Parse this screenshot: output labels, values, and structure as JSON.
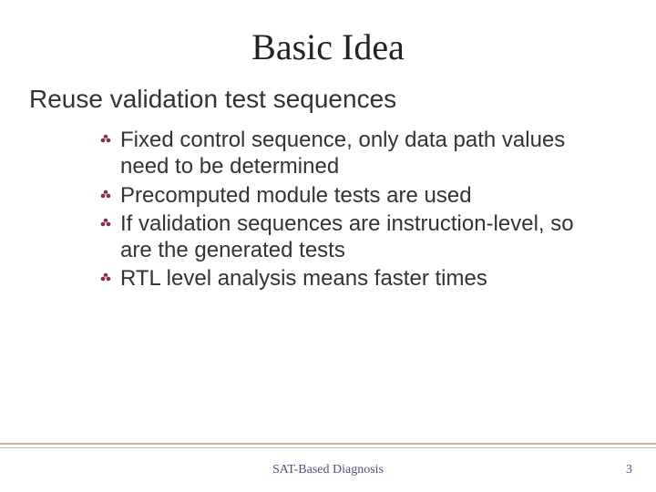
{
  "title": "Basic Idea",
  "subtitle": "Reuse validation test sequences",
  "bullets": [
    "Fixed control sequence, only data path values need to be determined",
    "Precomputed module tests are used",
    "If validation sequences are instruction-level, so are the generated tests",
    "RTL level analysis means faster times"
  ],
  "footer": "SAT-Based Diagnosis",
  "page_number": "3",
  "colors": {
    "accent_line": "#c9b98a",
    "footer_text": "#5a4a7a",
    "bullet_fill": "#8a2a5a"
  }
}
